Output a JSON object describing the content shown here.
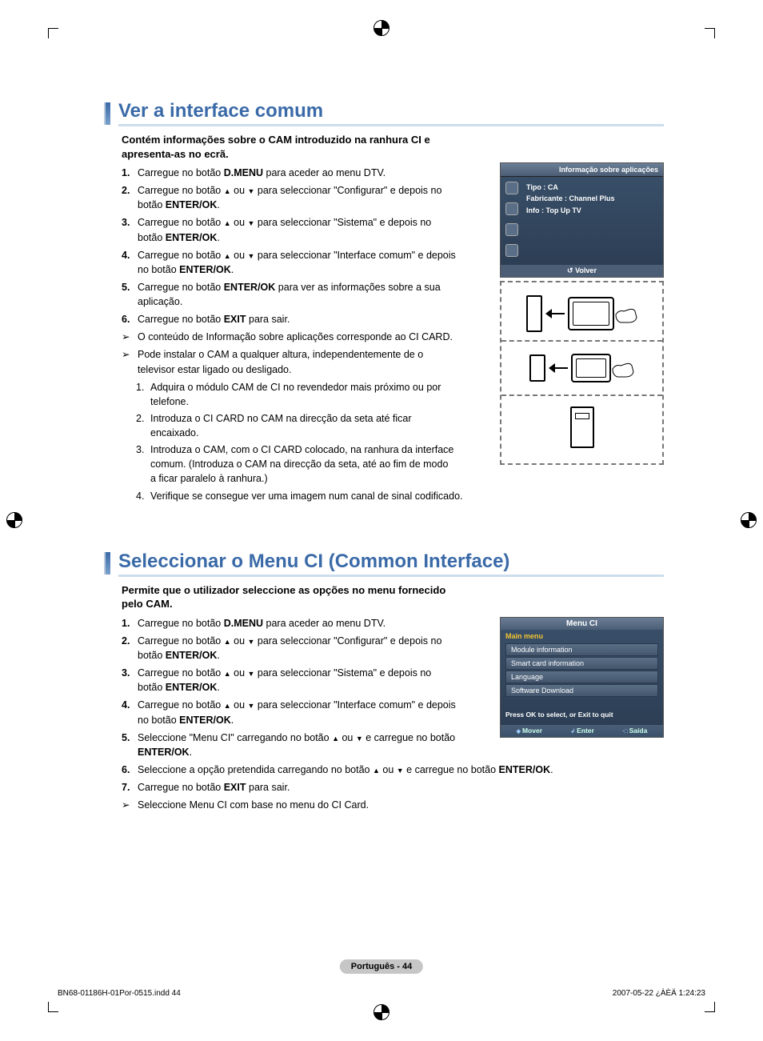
{
  "section1": {
    "title": "Ver a interface comum",
    "intro": "Contém informações sobre o CAM introduzido na ranhura CI e apresenta-as no ecrã.",
    "steps": [
      "Carregue no botão D.MENU para aceder ao menu DTV.",
      "Carregue no botão ▲ ou ▼ para seleccionar \"Configurar\" e depois no botão ENTER/OK.",
      "Carregue no botão ▲ ou ▼ para seleccionar \"Sistema\" e depois no botão ENTER/OK.",
      "Carregue no botão ▲ ou ▼ para seleccionar \"Interface comum\" e depois no botão ENTER/OK.",
      "Carregue no botão ENTER/OK para ver as informações sobre a sua aplicação.",
      "Carregue no botão EXIT para sair."
    ],
    "notes": [
      "O conteúdo de Informação sobre aplicações corresponde ao CI CARD.",
      "Pode instalar o CAM a qualquer altura, independentemente de o televisor estar ligado ou desligado."
    ],
    "substeps": [
      "Adquira o módulo CAM de CI no revendedor mais próximo ou por telefone.",
      "Introduza o CI CARD no CAM na direcção da seta até ficar encaixado.",
      "Introduza o CAM, com o CI CARD colocado, na ranhura da interface comum. (Introduza o CAM na direcção da seta, até ao fim de modo a ficar paralelo à ranhura.)",
      "Verifique se consegue ver uma imagem num canal de sinal codificado."
    ]
  },
  "section2": {
    "title": "Seleccionar o Menu CI (Common Interface)",
    "intro": "Permite que o utilizador seleccione as opções no menu fornecido pelo CAM.",
    "steps": [
      "Carregue no botão D.MENU para aceder ao menu DTV.",
      "Carregue no botão ▲ ou ▼ para seleccionar \"Configurar\" e depois no botão ENTER/OK.",
      "Carregue no botão ▲ ou ▼ para seleccionar \"Sistema\" e depois no botão ENTER/OK.",
      "Carregue no botão ▲ ou ▼ para seleccionar \"Interface comum\" e depois no botão ENTER/OK.",
      "Seleccione \"Menu CI\" carregando no botão ▲ ou ▼ e carregue no botão ENTER/OK.",
      "Seleccione a opção pretendida carregando no botão ▲ ou ▼ e carregue no botão ENTER/OK.",
      "Carregue no botão EXIT para sair."
    ],
    "notes": [
      "Seleccione Menu CI com base no menu do CI Card."
    ]
  },
  "osd1": {
    "title": "Informação sobre aplicações",
    "lines": [
      "Tipo : CA",
      "Fabricante : Channel Plus",
      "Info : Top Up TV"
    ],
    "footer": "Volver"
  },
  "osd2": {
    "title": "Menu CI",
    "subtitle": "Main menu",
    "items": [
      "Module information",
      "Smart card information",
      "Language",
      "Software Download"
    ],
    "hint": "Press OK to select, or Exit to quit",
    "footer": {
      "move": "Mover",
      "enter": "Enter",
      "exit": "Saída"
    }
  },
  "page_badge": "Português - 44",
  "footer": {
    "left": "BN68-01186H-01Por-0515.indd   44",
    "right": "2007-05-22   ¿ÀÈÄ 1:24:23"
  }
}
